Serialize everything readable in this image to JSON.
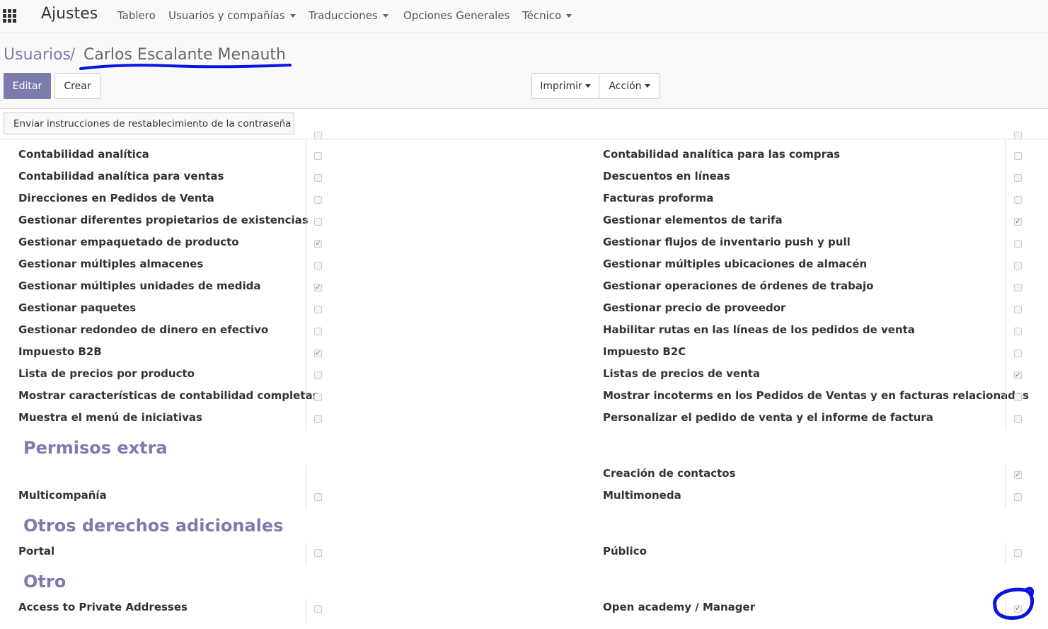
{
  "topbar": {
    "app_title": "Ajustes",
    "menus": [
      "Tablero",
      "Usuarios y compañías",
      "Traducciones",
      "Opciones Generales",
      "Técnico"
    ]
  },
  "breadcrumb": {
    "parent": "Usuarios",
    "separator": "/",
    "current": "Carlos Escalante Menauth"
  },
  "buttons": {
    "edit": "Editar",
    "create": "Crear",
    "print": "Imprimir",
    "action": "Acción",
    "reset_password": "Enviar instrucciones de restablecimiento de la contraseña"
  },
  "technical_rows": [
    {
      "left": "Contabilidad analítica",
      "left_checked": false,
      "right": "Contabilidad analítica para las compras",
      "right_checked": false
    },
    {
      "left": "Contabilidad analítica para ventas",
      "left_checked": false,
      "right": "Descuentos en líneas",
      "right_checked": false
    },
    {
      "left": "Direcciones en Pedidos de Venta",
      "left_checked": false,
      "right": "Facturas proforma",
      "right_checked": false
    },
    {
      "left": "Gestionar diferentes propietarios de existencias",
      "left_checked": false,
      "right": "Gestionar elementos de tarifa",
      "right_checked": true
    },
    {
      "left": "Gestionar empaquetado de producto",
      "left_checked": true,
      "right": "Gestionar flujos de inventario push y pull",
      "right_checked": false
    },
    {
      "left": "Gestionar múltiples almacenes",
      "left_checked": false,
      "right": "Gestionar múltiples ubicaciones de almacén",
      "right_checked": false
    },
    {
      "left": "Gestionar múltiples unidades de medida",
      "left_checked": true,
      "right": "Gestionar operaciones de órdenes de trabajo",
      "right_checked": false
    },
    {
      "left": "Gestionar paquetes",
      "left_checked": false,
      "right": "Gestionar precio de proveedor",
      "right_checked": false
    },
    {
      "left": "Gestionar redondeo de dinero en efectivo",
      "left_checked": false,
      "right": "Habilitar rutas en las líneas de los pedidos de venta",
      "right_checked": false
    },
    {
      "left": "Impuesto B2B",
      "left_checked": true,
      "right": "Impuesto B2C",
      "right_checked": false
    },
    {
      "left": "Lista de precios por producto",
      "left_checked": false,
      "right": "Listas de precios de venta",
      "right_checked": true
    },
    {
      "left": "Mostrar características de contabilidad completas",
      "left_checked": false,
      "right": "Mostrar incoterms en los Pedidos de Ventas y en facturas relacionadas",
      "right_checked": false
    },
    {
      "left": "Muestra el menú de iniciativas",
      "left_checked": false,
      "right": "Personalizar el pedido de venta y el informe de factura",
      "right_checked": false
    }
  ],
  "sections": {
    "extra": {
      "title": "Permisos extra",
      "rows": [
        {
          "left": "",
          "left_checked": null,
          "right": "Creación de contactos",
          "right_checked": true
        },
        {
          "left": "Multicompañía",
          "left_checked": false,
          "right": "Multimoneda",
          "right_checked": false
        }
      ]
    },
    "other_rights": {
      "title": "Otros derechos adicionales",
      "rows": [
        {
          "left": "Portal",
          "left_checked": false,
          "right": "Público",
          "right_checked": false
        }
      ]
    },
    "other": {
      "title": "Otro",
      "rows": [
        {
          "left": "Access to Private Addresses",
          "left_checked": false,
          "right": "Open academy / Manager",
          "right_checked": true
        }
      ]
    }
  },
  "colors": {
    "accent": "#7c7bad",
    "annotation": "#0a14e0"
  }
}
